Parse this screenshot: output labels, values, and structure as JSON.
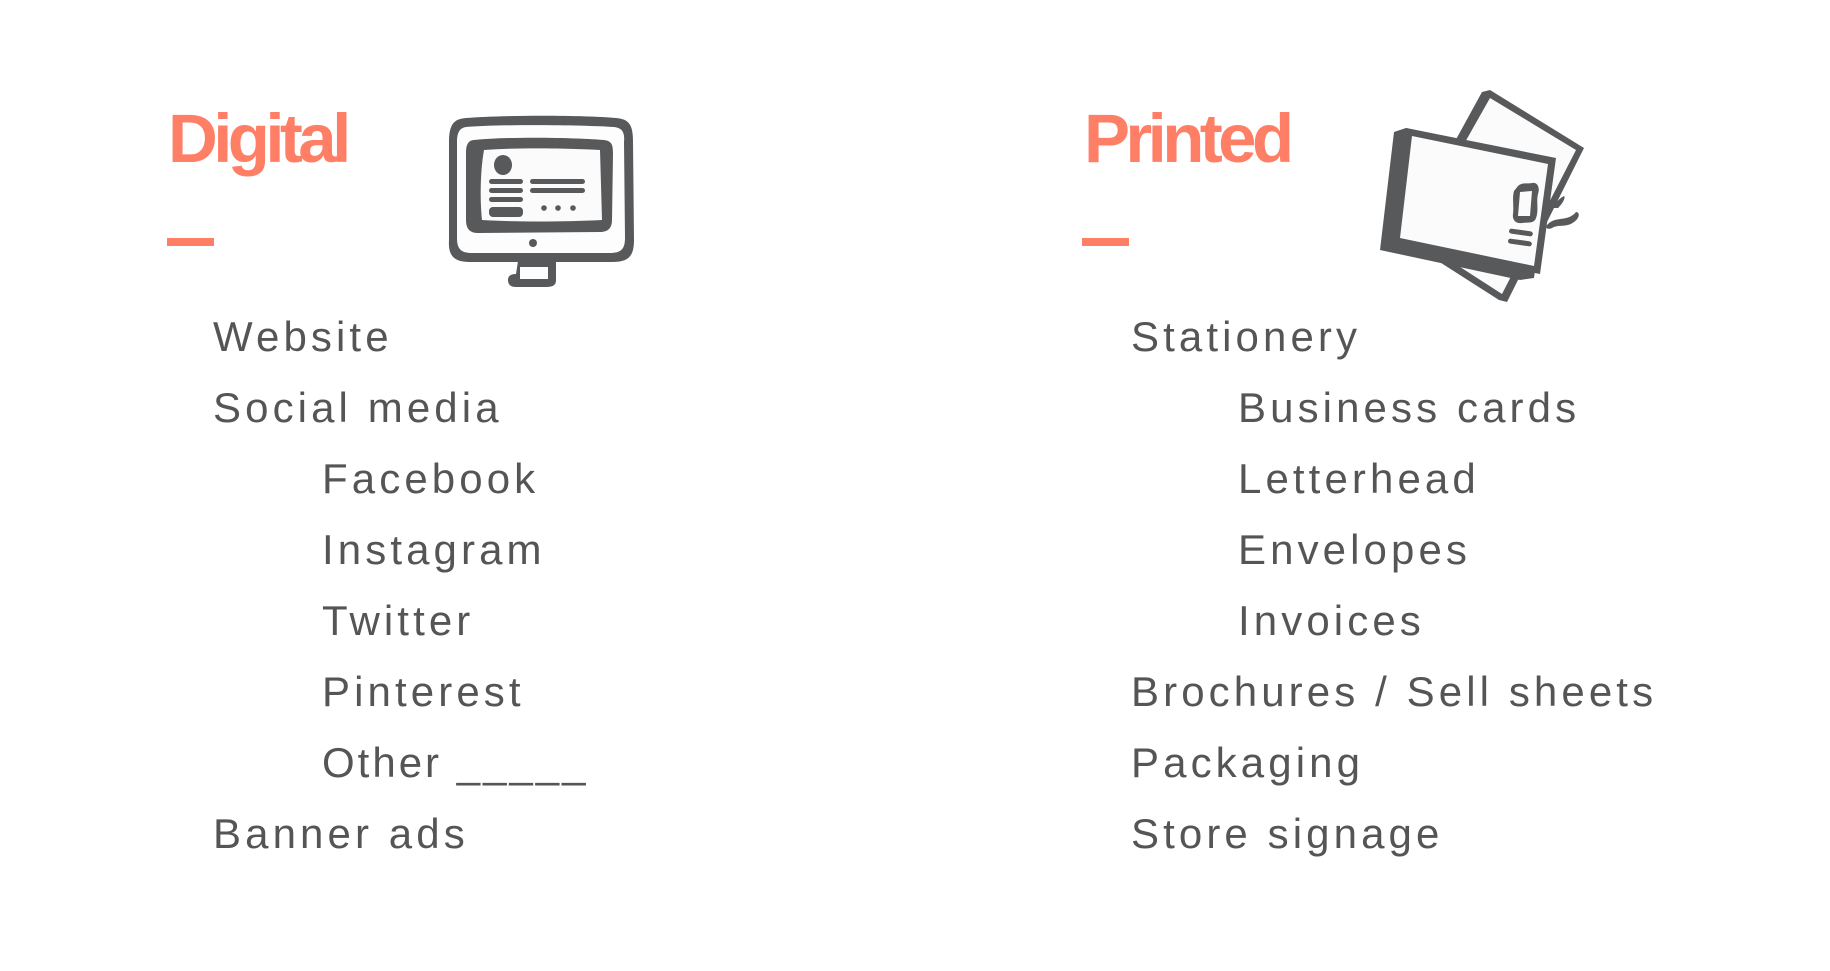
{
  "accent_color": "#ff7f66",
  "text_color": "#555555",
  "columns": [
    {
      "heading": "Digital",
      "icon": "monitor-icon",
      "items": [
        {
          "label": "Website",
          "level": 0
        },
        {
          "label": "Social media",
          "level": 0
        },
        {
          "label": "Facebook",
          "level": 1
        },
        {
          "label": "Instagram",
          "level": 1
        },
        {
          "label": "Twitter",
          "level": 1
        },
        {
          "label": "Pinterest",
          "level": 1
        },
        {
          "label": "Other _____",
          "level": 1
        },
        {
          "label": "Banner ads",
          "level": 0
        }
      ]
    },
    {
      "heading": "Printed",
      "icon": "envelopes-icon",
      "items": [
        {
          "label": "Stationery",
          "level": 0
        },
        {
          "label": "Business cards",
          "level": 1
        },
        {
          "label": "Letterhead",
          "level": 1
        },
        {
          "label": "Envelopes",
          "level": 1
        },
        {
          "label": "Invoices",
          "level": 1
        },
        {
          "label": "Brochures / Sell sheets",
          "level": 0
        },
        {
          "label": "Packaging",
          "level": 0
        },
        {
          "label": "Store signage",
          "level": 0
        }
      ]
    }
  ]
}
